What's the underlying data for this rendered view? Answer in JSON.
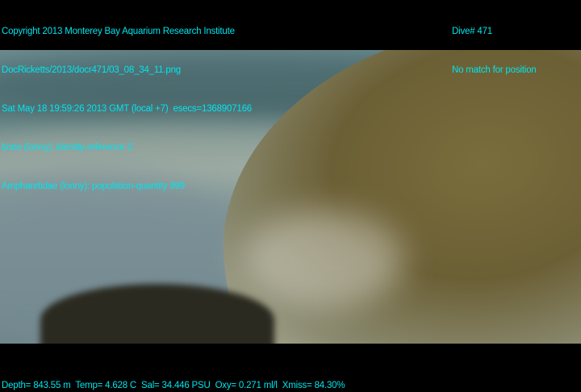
{
  "overlay_top_left": [
    "Copyright 2013 Monterey Bay Aquarium Research Institute",
    "DocRicketts/2013/docr471/03_08_34_11.png",
    "Sat May 18 19:59:26 2013 GMT (local +7)  esecs=1368907166",
    "bone (lonny): identity-reference 2",
    "Ampharetidae (lonny): population-quantity 999"
  ],
  "overlay_top_right": [
    "Dive# 471",
    "No match for position"
  ],
  "overlay_bottom": "Depth= 843.55 m  Temp= 4.628 C  Sal= 34.446 PSU  Oxy= 0.271 ml/l  Xmiss= 84.30%"
}
